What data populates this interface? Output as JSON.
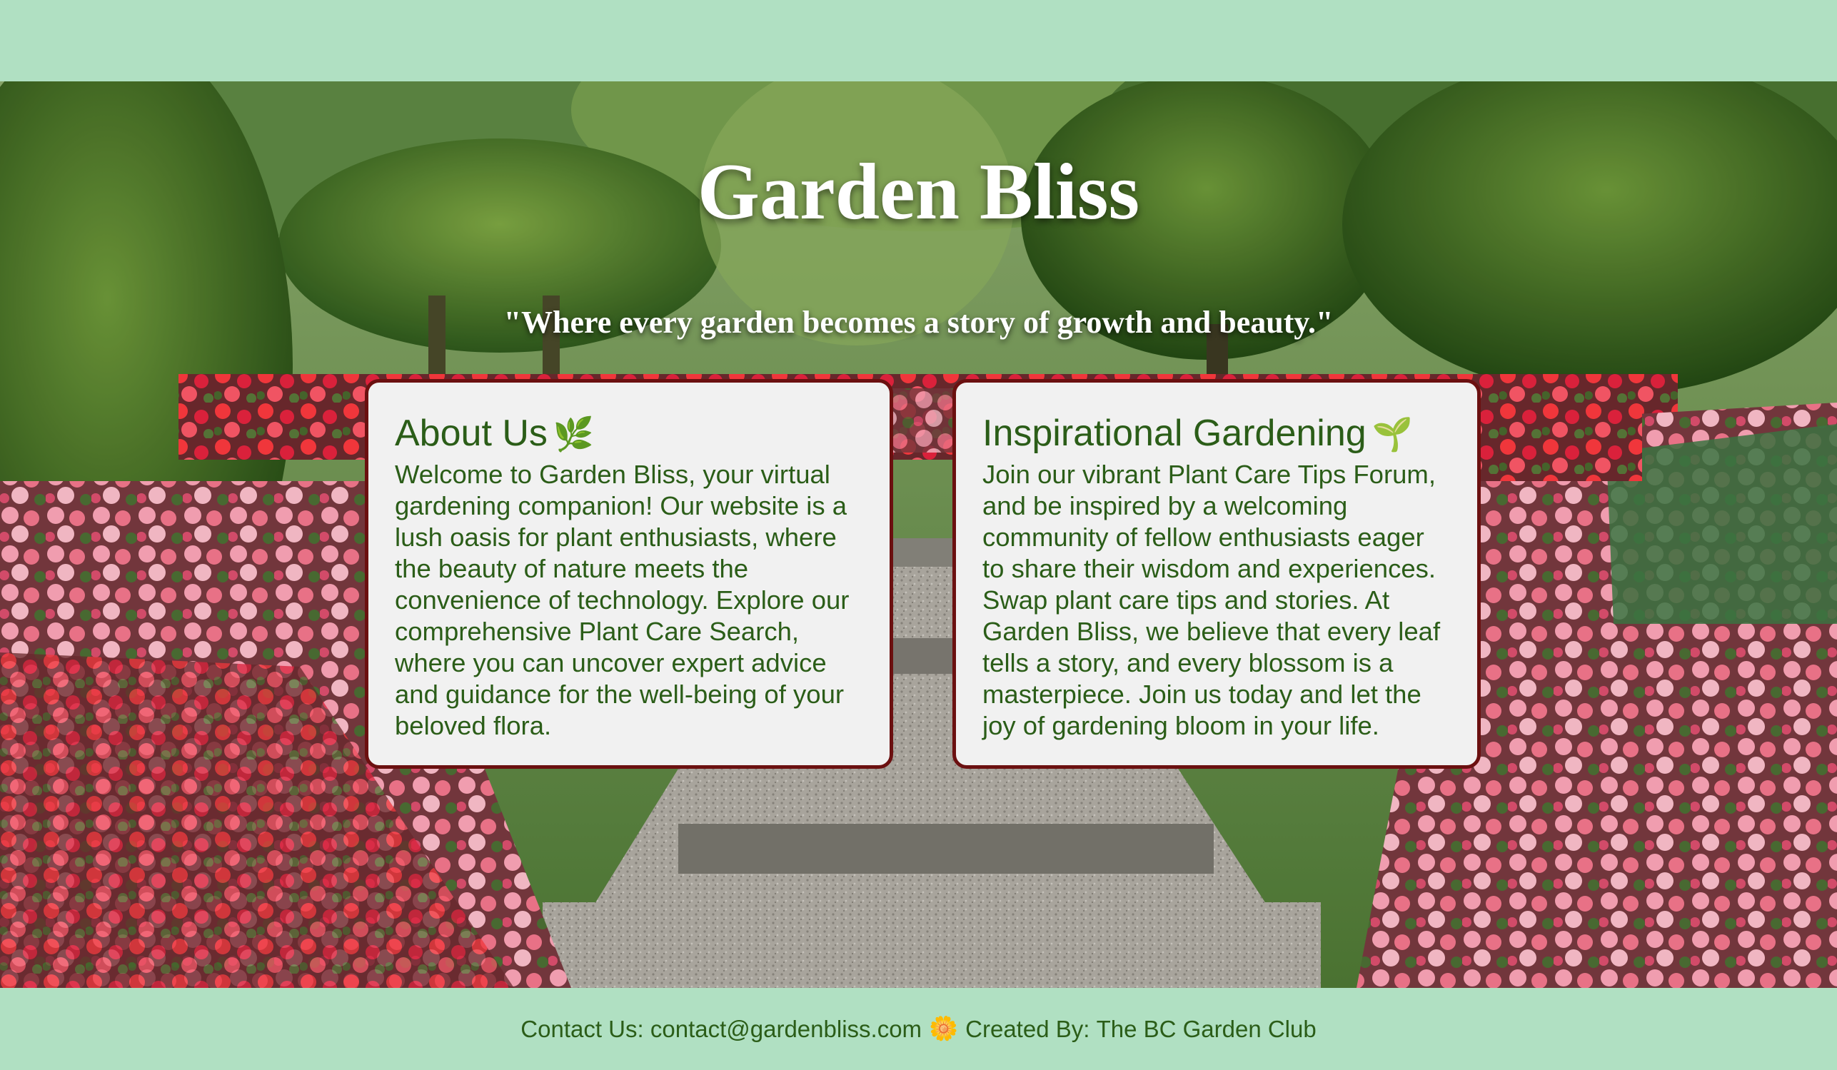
{
  "header": {
    "title": "Garden Bliss",
    "tagline": "\"Where every garden becomes a story of growth and beauty.\""
  },
  "about": {
    "heading": "About Us",
    "heading_icon": "🌿",
    "body": "Welcome to Garden Bliss, your virtual gardening companion! Our website is a lush oasis for plant enthusiasts, where the beauty of nature meets the convenience of technology. Explore our comprehensive Plant Care Search, where you can uncover expert advice and guidance for the well-being of your beloved flora."
  },
  "inspiration": {
    "heading": "Inspirational Gardening",
    "heading_icon": "🌱",
    "body": "Join our vibrant Plant Care Tips Forum, and be inspired by a welcoming community of fellow enthusiasts eager to share their wisdom and experiences. Swap plant care tips and stories. At Garden Bliss, we believe that every leaf tells a story, and every blossom is a masterpiece. Join us today and let the joy of gardening bloom in your life."
  },
  "footer": {
    "contact_label": "Contact Us:",
    "email": "contact@gardenbliss.com",
    "separator_icon": "🌼",
    "credit_label": "Created By:",
    "credit_name": "The BC Garden Club"
  },
  "colors": {
    "band_background": "#b0e0c2",
    "card_background": "#f1f1f1",
    "card_border": "#6b1010",
    "text_green": "#2b5d18",
    "title_white": "#ffffff"
  }
}
